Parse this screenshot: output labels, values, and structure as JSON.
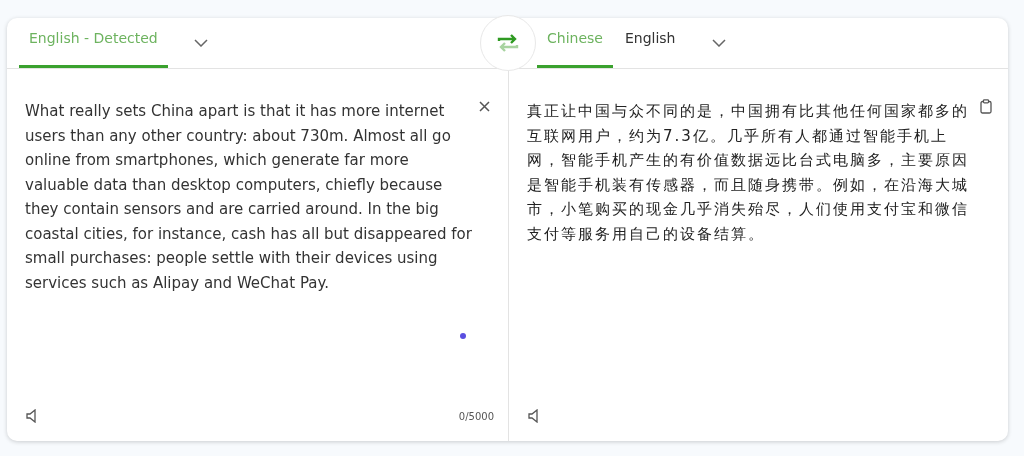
{
  "source": {
    "tabs": [
      {
        "label": "English - Detected",
        "selected": true
      }
    ],
    "text": "What really sets China apart is that it has more internet users than any other country: about 730m. Almost all go online from smartphones, which generate far more valuable data than desktop computers, chiefly because they contain sensors and are carried around. In the big coastal cities, for instance, cash has all but disappeared for small purchases: people settle with their devices using services such as Alipay and WeChat Pay.",
    "counter": "0/5000"
  },
  "target": {
    "tabs": [
      {
        "label": "Chinese",
        "selected": true
      },
      {
        "label": "English",
        "selected": false
      }
    ],
    "text": "真正让中国与众不同的是，中国拥有比其他任何国家都多的互联网用户，约为7.3亿。几乎所有人都通过智能手机上网，智能手机产生的有价值数据远比台式电脑多，主要原因是智能手机装有传感器，而且随身携带。例如，在沿海大城市，小笔购买的现金几乎消失殆尽，人们使用支付宝和微信支付等服务用自己的设备结算。"
  }
}
